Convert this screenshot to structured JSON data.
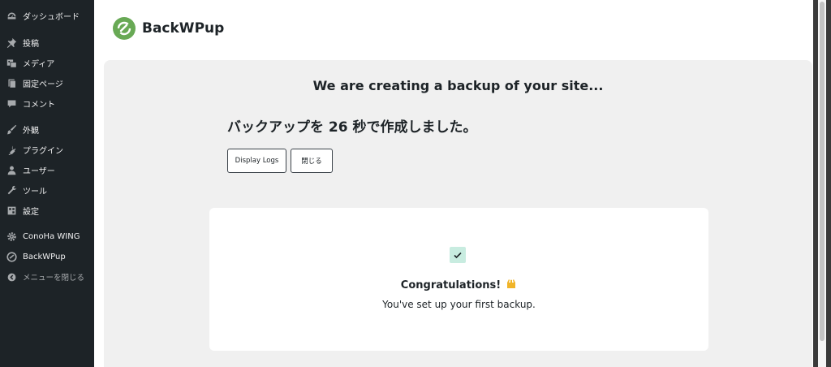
{
  "sidebar": {
    "items": [
      {
        "label": "ダッシュボード",
        "icon": "dashboard-icon"
      },
      {
        "label": "投稿",
        "icon": "pin-icon"
      },
      {
        "label": "メディア",
        "icon": "media-icon"
      },
      {
        "label": "固定ページ",
        "icon": "page-icon"
      },
      {
        "label": "コメント",
        "icon": "comment-icon"
      },
      {
        "label": "外観",
        "icon": "brush-icon"
      },
      {
        "label": "プラグイン",
        "icon": "plugin-icon"
      },
      {
        "label": "ユーザー",
        "icon": "user-icon"
      },
      {
        "label": "ツール",
        "icon": "wrench-icon"
      },
      {
        "label": "設定",
        "icon": "settings-icon"
      },
      {
        "label": "ConoHa WING",
        "icon": "gear-icon"
      },
      {
        "label": "BackWPup",
        "icon": "backwpup-icon"
      }
    ],
    "collapse_label": "メニューを閉じる"
  },
  "header": {
    "logo_text": "BackWPup",
    "brand_color": "#68a955"
  },
  "main": {
    "headline": "We are creating a backup of your site...",
    "status": "バックアップを 26 秒で作成しました。",
    "display_logs_label": "Display Logs",
    "close_label": "閉じる"
  },
  "card": {
    "title": "Congratulations!",
    "emoji": "🙌",
    "subtitle": "You've set up your first backup."
  }
}
